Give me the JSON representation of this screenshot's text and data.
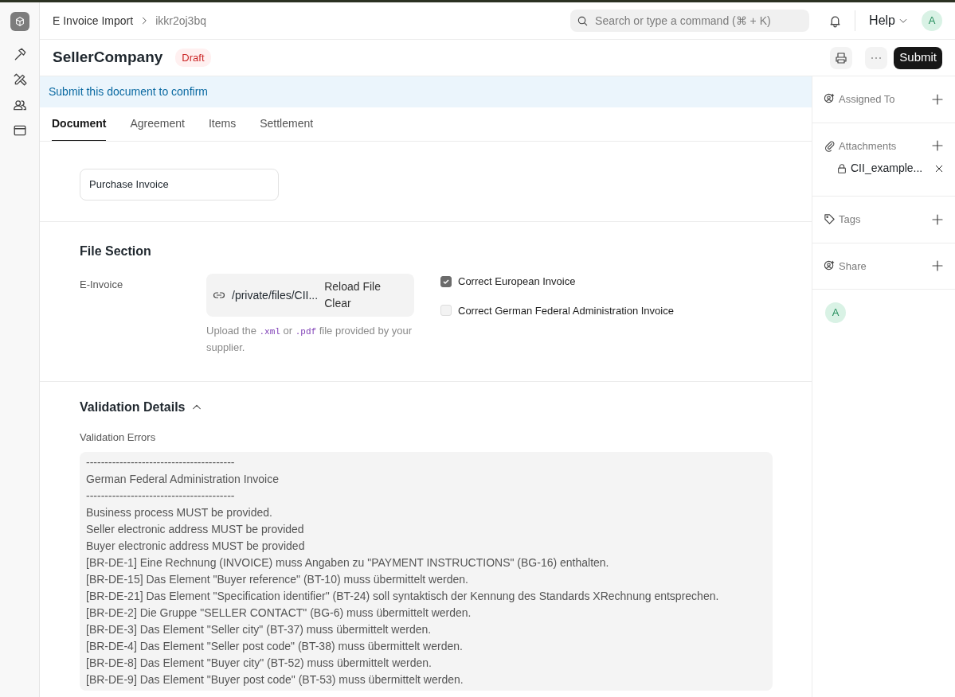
{
  "breadcrumb": [
    {
      "label": "E Invoice Import"
    },
    {
      "label": "ikkr2oj3bq"
    }
  ],
  "search": {
    "placeholder": "Search or type a command (⌘ + K)"
  },
  "help": {
    "label": "Help"
  },
  "user_avatar": {
    "initial": "A"
  },
  "header": {
    "title": "SellerCompany",
    "status": "Draft",
    "primary_action": "Submit"
  },
  "alert": "Submit this document to confirm",
  "tabs": [
    {
      "label": "Document",
      "selected": true
    },
    {
      "label": "Agreement",
      "selected": false
    },
    {
      "label": "Items",
      "selected": false
    },
    {
      "label": "Settlement",
      "selected": false
    }
  ],
  "document_type": {
    "value": "Purchase Invoice"
  },
  "file_section": {
    "title": "File Section",
    "field_label": "E-Invoice",
    "file_path": "/private/files/CII...",
    "actions": [
      "Reload File",
      "Clear"
    ],
    "description": [
      {
        "kind": "text",
        "text": "Upload the "
      },
      {
        "kind": "code",
        "text": ".xml"
      },
      {
        "kind": "text",
        "text": " or "
      },
      {
        "kind": "code",
        "text": ".pdf"
      },
      {
        "kind": "text",
        "text": " file provided by your supplier."
      }
    ],
    "checkboxes": [
      {
        "label": "Correct European Invoice",
        "checked": true
      },
      {
        "label": "Correct German Federal Administration Invoice",
        "checked": false
      }
    ]
  },
  "validation": {
    "title": "Validation Details",
    "expanded": true,
    "field_label": "Validation Errors",
    "lines": [
      "----------------------------------------",
      "German Federal Administration Invoice",
      "----------------------------------------",
      "Business process MUST be provided.",
      "Seller electronic address MUST be provided",
      "Buyer electronic address MUST be provided",
      "[BR-DE-1] Eine Rechnung (INVOICE) muss Angaben zu \"PAYMENT INSTRUCTIONS\" (BG-16) enthalten.",
      "[BR-DE-15] Das Element \"Buyer reference\" (BT-10) muss übermittelt werden.",
      "[BR-DE-21] Das Element \"Specification identifier\" (BT-24) soll syntaktisch der Kennung des Standards XRechnung entsprechen.",
      "[BR-DE-2] Die Gruppe \"SELLER CONTACT\" (BG-6) muss übermittelt werden.",
      "[BR-DE-3] Das Element \"Seller city\" (BT-37) muss übermittelt werden.",
      "[BR-DE-4] Das Element \"Seller post code\" (BT-38) muss übermittelt werden.",
      "[BR-DE-8] Das Element \"Buyer city\" (BT-52) muss übermittelt werden.",
      "[BR-DE-9] Das Element \"Buyer post code\" (BT-53) muss übermittelt werden."
    ]
  },
  "sidebar": {
    "sections": [
      {
        "kind": "assign",
        "label": "Assigned To"
      },
      {
        "kind": "attach",
        "label": "Attachments",
        "items": [
          {
            "name": "CII_example..."
          }
        ]
      },
      {
        "kind": "tag",
        "label": "Tags"
      },
      {
        "kind": "share",
        "label": "Share"
      }
    ],
    "viewer": {
      "initial": "A"
    }
  }
}
